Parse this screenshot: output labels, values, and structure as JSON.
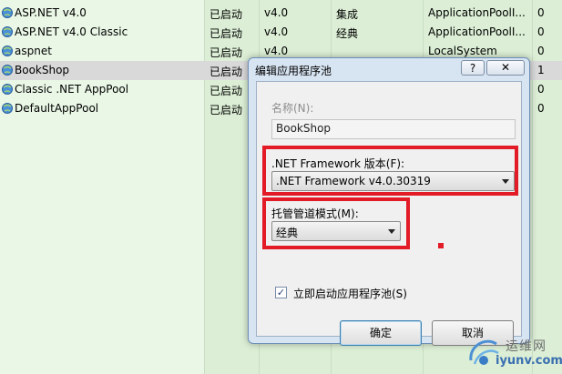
{
  "pools": [
    {
      "name": "ASP.NET v4.0",
      "state": "已启动",
      "version": "v4.0",
      "mode": "集成",
      "identity": "ApplicationPoolI...",
      "apps": "0",
      "selected": false
    },
    {
      "name": "ASP.NET v4.0 Classic",
      "state": "已启动",
      "version": "v4.0",
      "mode": "经典",
      "identity": "ApplicationPoolI...",
      "apps": "0",
      "selected": false
    },
    {
      "name": "aspnet",
      "state": "已启动",
      "version": "v4.0",
      "mode": "",
      "identity": "LocalSystem",
      "apps": "0",
      "selected": false
    },
    {
      "name": "BookShop",
      "state": "已启动",
      "version": "",
      "mode": "",
      "identity": "",
      "apps": "1",
      "selected": true
    },
    {
      "name": "Classic .NET AppPool",
      "state": "已启动",
      "version": "",
      "mode": "",
      "identity": "",
      "apps": "0",
      "selected": false
    },
    {
      "name": "DefaultAppPool",
      "state": "已启动",
      "version": "",
      "mode": "",
      "identity": "",
      "apps": "0",
      "selected": false
    }
  ],
  "dialog": {
    "title": "编辑应用程序池",
    "help_label": "?",
    "close_label": "✕",
    "name_label": "名称(N):",
    "name_value": "BookShop",
    "framework_label": ".NET Framework 版本(F):",
    "framework_value": ".NET Framework v4.0.30319",
    "pipeline_label": "托管管道模式(M):",
    "pipeline_value": "经典",
    "autostart_label": "立即启动应用程序池(S)",
    "autostart_checked": true,
    "ok_label": "确定",
    "cancel_label": "取消"
  },
  "watermark": {
    "cn": "运维网",
    "en": "iyunv.com"
  },
  "colors": {
    "highlight_red": "#e21b26",
    "list_green": "#dcefd6",
    "dialog_frame": "#d7e4f2"
  }
}
